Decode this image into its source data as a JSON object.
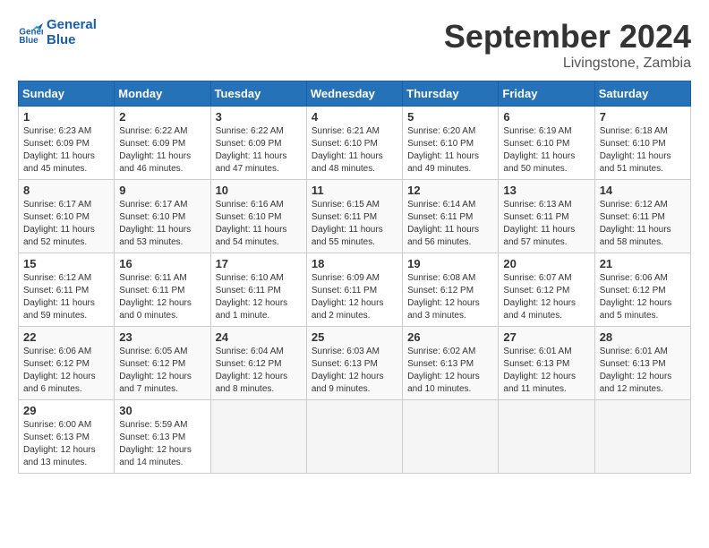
{
  "header": {
    "logo_line1": "General",
    "logo_line2": "Blue",
    "month_title": "September 2024",
    "location": "Livingstone, Zambia"
  },
  "weekdays": [
    "Sunday",
    "Monday",
    "Tuesday",
    "Wednesday",
    "Thursday",
    "Friday",
    "Saturday"
  ],
  "weeks": [
    [
      {
        "day": "1",
        "sunrise": "6:23 AM",
        "sunset": "6:09 PM",
        "daylight": "11 hours and 45 minutes."
      },
      {
        "day": "2",
        "sunrise": "6:22 AM",
        "sunset": "6:09 PM",
        "daylight": "11 hours and 46 minutes."
      },
      {
        "day": "3",
        "sunrise": "6:22 AM",
        "sunset": "6:09 PM",
        "daylight": "11 hours and 47 minutes."
      },
      {
        "day": "4",
        "sunrise": "6:21 AM",
        "sunset": "6:10 PM",
        "daylight": "11 hours and 48 minutes."
      },
      {
        "day": "5",
        "sunrise": "6:20 AM",
        "sunset": "6:10 PM",
        "daylight": "11 hours and 49 minutes."
      },
      {
        "day": "6",
        "sunrise": "6:19 AM",
        "sunset": "6:10 PM",
        "daylight": "11 hours and 50 minutes."
      },
      {
        "day": "7",
        "sunrise": "6:18 AM",
        "sunset": "6:10 PM",
        "daylight": "11 hours and 51 minutes."
      }
    ],
    [
      {
        "day": "8",
        "sunrise": "6:17 AM",
        "sunset": "6:10 PM",
        "daylight": "11 hours and 52 minutes."
      },
      {
        "day": "9",
        "sunrise": "6:17 AM",
        "sunset": "6:10 PM",
        "daylight": "11 hours and 53 minutes."
      },
      {
        "day": "10",
        "sunrise": "6:16 AM",
        "sunset": "6:10 PM",
        "daylight": "11 hours and 54 minutes."
      },
      {
        "day": "11",
        "sunrise": "6:15 AM",
        "sunset": "6:11 PM",
        "daylight": "11 hours and 55 minutes."
      },
      {
        "day": "12",
        "sunrise": "6:14 AM",
        "sunset": "6:11 PM",
        "daylight": "11 hours and 56 minutes."
      },
      {
        "day": "13",
        "sunrise": "6:13 AM",
        "sunset": "6:11 PM",
        "daylight": "11 hours and 57 minutes."
      },
      {
        "day": "14",
        "sunrise": "6:12 AM",
        "sunset": "6:11 PM",
        "daylight": "11 hours and 58 minutes."
      }
    ],
    [
      {
        "day": "15",
        "sunrise": "6:12 AM",
        "sunset": "6:11 PM",
        "daylight": "11 hours and 59 minutes."
      },
      {
        "day": "16",
        "sunrise": "6:11 AM",
        "sunset": "6:11 PM",
        "daylight": "12 hours and 0 minutes."
      },
      {
        "day": "17",
        "sunrise": "6:10 AM",
        "sunset": "6:11 PM",
        "daylight": "12 hours and 1 minute."
      },
      {
        "day": "18",
        "sunrise": "6:09 AM",
        "sunset": "6:11 PM",
        "daylight": "12 hours and 2 minutes."
      },
      {
        "day": "19",
        "sunrise": "6:08 AM",
        "sunset": "6:12 PM",
        "daylight": "12 hours and 3 minutes."
      },
      {
        "day": "20",
        "sunrise": "6:07 AM",
        "sunset": "6:12 PM",
        "daylight": "12 hours and 4 minutes."
      },
      {
        "day": "21",
        "sunrise": "6:06 AM",
        "sunset": "6:12 PM",
        "daylight": "12 hours and 5 minutes."
      }
    ],
    [
      {
        "day": "22",
        "sunrise": "6:06 AM",
        "sunset": "6:12 PM",
        "daylight": "12 hours and 6 minutes."
      },
      {
        "day": "23",
        "sunrise": "6:05 AM",
        "sunset": "6:12 PM",
        "daylight": "12 hours and 7 minutes."
      },
      {
        "day": "24",
        "sunrise": "6:04 AM",
        "sunset": "6:12 PM",
        "daylight": "12 hours and 8 minutes."
      },
      {
        "day": "25",
        "sunrise": "6:03 AM",
        "sunset": "6:13 PM",
        "daylight": "12 hours and 9 minutes."
      },
      {
        "day": "26",
        "sunrise": "6:02 AM",
        "sunset": "6:13 PM",
        "daylight": "12 hours and 10 minutes."
      },
      {
        "day": "27",
        "sunrise": "6:01 AM",
        "sunset": "6:13 PM",
        "daylight": "12 hours and 11 minutes."
      },
      {
        "day": "28",
        "sunrise": "6:01 AM",
        "sunset": "6:13 PM",
        "daylight": "12 hours and 12 minutes."
      }
    ],
    [
      {
        "day": "29",
        "sunrise": "6:00 AM",
        "sunset": "6:13 PM",
        "daylight": "12 hours and 13 minutes."
      },
      {
        "day": "30",
        "sunrise": "5:59 AM",
        "sunset": "6:13 PM",
        "daylight": "12 hours and 14 minutes."
      },
      null,
      null,
      null,
      null,
      null
    ]
  ]
}
